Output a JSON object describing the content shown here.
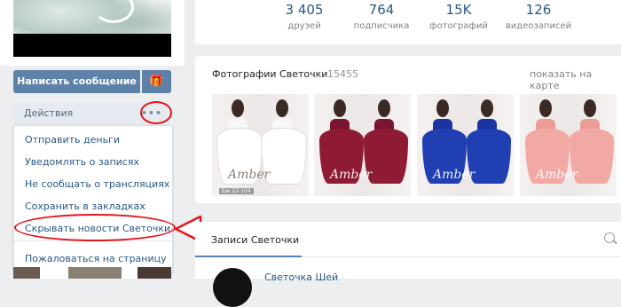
{
  "profile": {
    "message_button": "Написать сообщение",
    "gift_icon": "gift-icon",
    "actions_label": "Действия",
    "actions_dots": "•••"
  },
  "actions_menu": {
    "items": [
      "Отправить деньги",
      "Уведомлять о записях",
      "Не сообщать о трансляциях",
      "Сохранить в закладках",
      "Скрывать новости Светочки",
      "Пожаловаться на страницу"
    ]
  },
  "counters": [
    {
      "value": "3 405",
      "label": "друзей"
    },
    {
      "value": "764",
      "label": "подписчика"
    },
    {
      "value": "15K",
      "label": "фотографий"
    },
    {
      "value": "126",
      "label": "видеозаписей"
    }
  ],
  "photos": {
    "title": "Фотографии Светочки",
    "count": "15455",
    "show_on_map": "показать на карте",
    "items": [
      {
        "watermark": "Amber",
        "caption": "Бж 22-104",
        "color": "#ffffff"
      },
      {
        "watermark": "Amber",
        "caption": "",
        "color": "#8e1a34"
      },
      {
        "watermark": "Amber",
        "caption": "",
        "color": "#1f3fb3"
      },
      {
        "watermark": "Amber",
        "caption": "",
        "color": "#f2a9a4"
      }
    ]
  },
  "posts": {
    "tab_label": "Записи Светочки",
    "author": "Светочка Шей"
  },
  "colors": {
    "accent": "#5e81a8",
    "link": "#2a5885",
    "annotation_red": "#e3161e"
  }
}
